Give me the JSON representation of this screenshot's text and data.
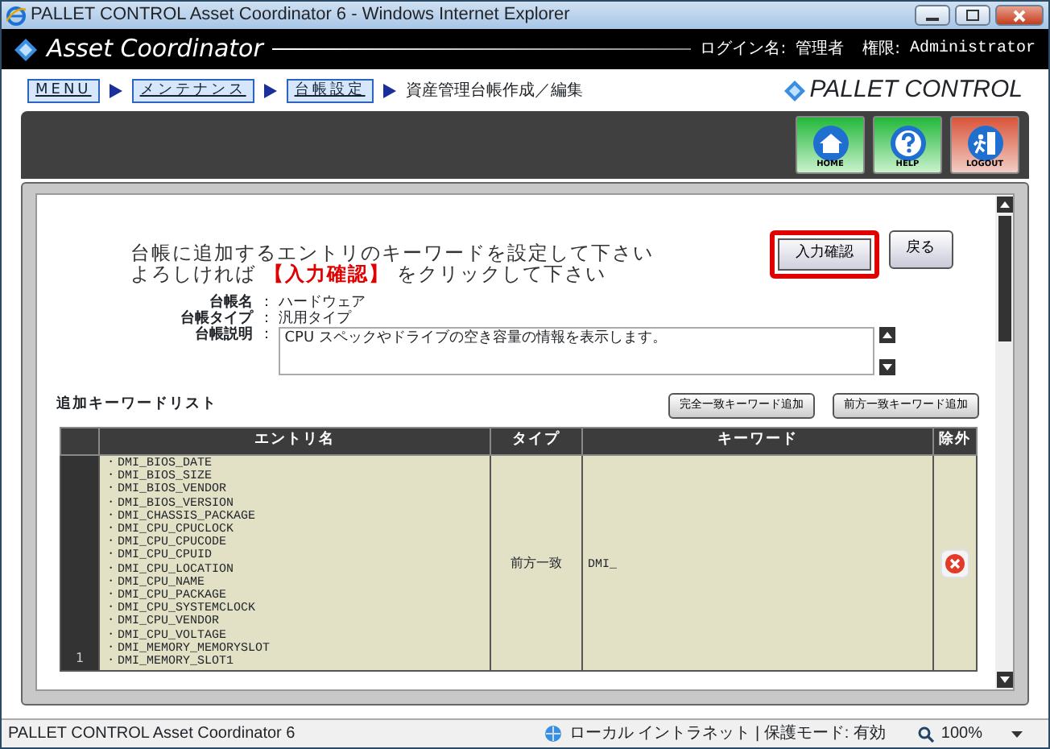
{
  "window": {
    "title": "PALLET CONTROL Asset Coordinator 6 - Windows Internet Explorer"
  },
  "header": {
    "app_name": "Asset Coordinator",
    "login_label": "ログイン名:",
    "login_value": "管理者",
    "role_label": "権限:",
    "role_value": "Administrator"
  },
  "breadcrumb": [
    {
      "label": "MENU",
      "kind": "link"
    },
    {
      "label": "メンテナンス",
      "kind": "link"
    },
    {
      "label": "台帳設定",
      "kind": "link"
    },
    {
      "label": "資産管理台帳作成／編集",
      "kind": "current"
    }
  ],
  "brand": "PALLET CONTROL",
  "nav_buttons": [
    {
      "label": "HOME",
      "kind": "home"
    },
    {
      "label": "HELP",
      "kind": "help"
    },
    {
      "label": "LOGOUT",
      "kind": "logout"
    }
  ],
  "instructions": [
    "台帳に追加するエントリのキーワードを設定して下さい",
    "よろしければ **【入力確認】** をクリックして下さい"
  ],
  "actions": [
    {
      "label": "入力確認",
      "highlighted": true
    },
    {
      "label": "戻る",
      "highlighted": false
    }
  ],
  "ledger": [
    {
      "label": "台帳名",
      "separator": "：",
      "value": "ハードウェア"
    },
    {
      "label": "台帳タイプ",
      "separator": "：",
      "value": "汎用タイプ"
    },
    {
      "label": "台帳説明",
      "separator": "：",
      "value": "CPU スペックやドライブの空き容量の情報を表示します。",
      "kind": "textarea"
    }
  ],
  "keyword_list": {
    "title": "追加キーワードリスト",
    "buttons": [
      "完全一致キーワード追加",
      "前方一致キーワード追加"
    ],
    "columns": [
      "エントリ名",
      "タイプ",
      "キーワード",
      "除外"
    ],
    "rows": [
      {
        "number": "1",
        "entries": [
          "・DMI_BIOS_DATE",
          "・DMI_BIOS_SIZE",
          "・DMI_BIOS_VENDOR",
          "・DMI_BIOS_VERSION",
          "・DMI_CHASSIS_PACKAGE",
          "・DMI_CPU_CPUCLOCK",
          "・DMI_CPU_CPUCODE",
          "・DMI_CPU_CPUID",
          "・DMI_CPU_LOCATION",
          "・DMI_CPU_NAME",
          "・DMI_CPU_PACKAGE",
          "・DMI_CPU_SYSTEMCLOCK",
          "・DMI_CPU_VENDOR",
          "・DMI_CPU_VOLTAGE",
          "・DMI_MEMORY_MEMORYSLOT",
          "・DMI_MEMORY_SLOT1"
        ],
        "type": "前方一致",
        "keyword": "DMI_"
      }
    ]
  },
  "status_bar": {
    "text": "PALLET CONTROL Asset Coordinator 6",
    "zone": "ローカル イントラネット | 保護モード: 有効",
    "zoom": "100%"
  }
}
